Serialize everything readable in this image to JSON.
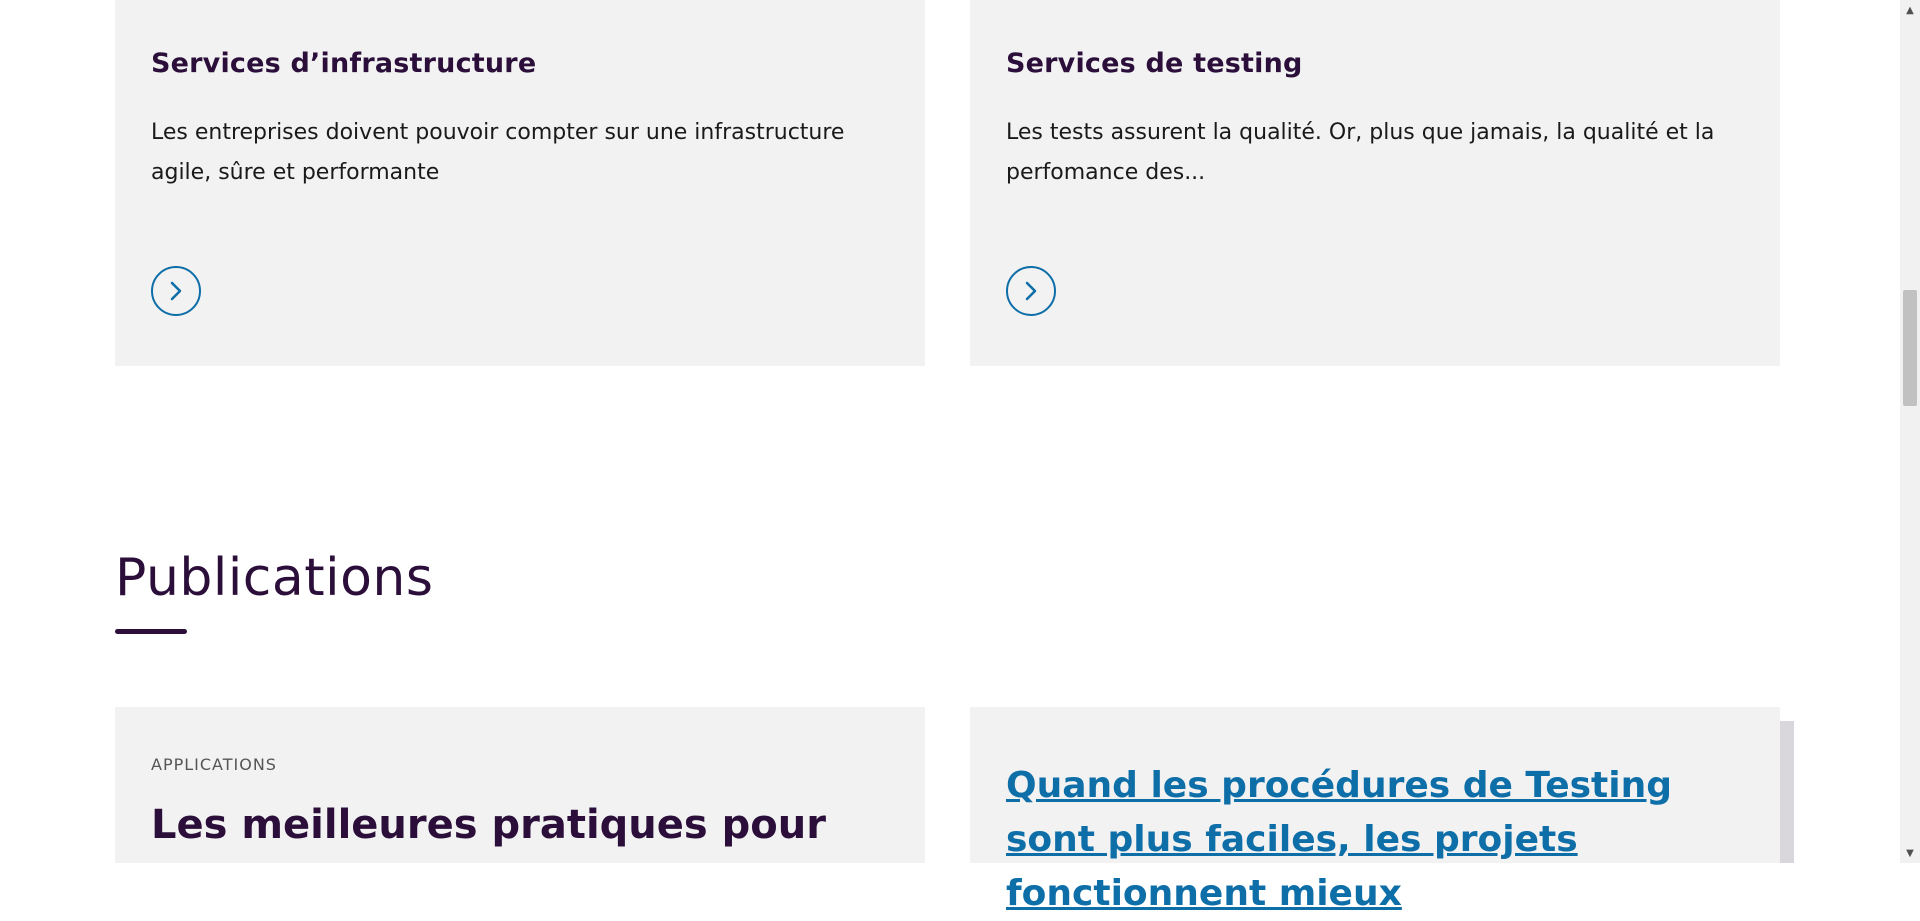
{
  "services": {
    "infrastructure": {
      "title": "Services d’infrastructure",
      "description": "Les entreprises doivent pouvoir compter sur une infrastructure agile, sûre et performante"
    },
    "testing": {
      "title": "Services de testing",
      "description": "Les tests assurent la qualité. Or, plus que jamais, la qualité et la perfomance des..."
    }
  },
  "publications": {
    "section_title": "Publications",
    "items": [
      {
        "category": "APPLICATIONS",
        "title": "Les meilleures pratiques pour"
      },
      {
        "title": "Quand les procédures de Testing sont plus faciles, les projets fonctionnent mieux"
      }
    ]
  },
  "icons": {
    "card_arrow": "chevron-right-circle-icon",
    "scroll_up": "scroll-up-arrow-icon",
    "scroll_down": "scroll-down-arrow-icon"
  },
  "colors": {
    "heading": "#2b0f3a",
    "link": "#0e6ea8",
    "card_bg": "#f2f2f2",
    "page_bg": "#ffffff"
  }
}
